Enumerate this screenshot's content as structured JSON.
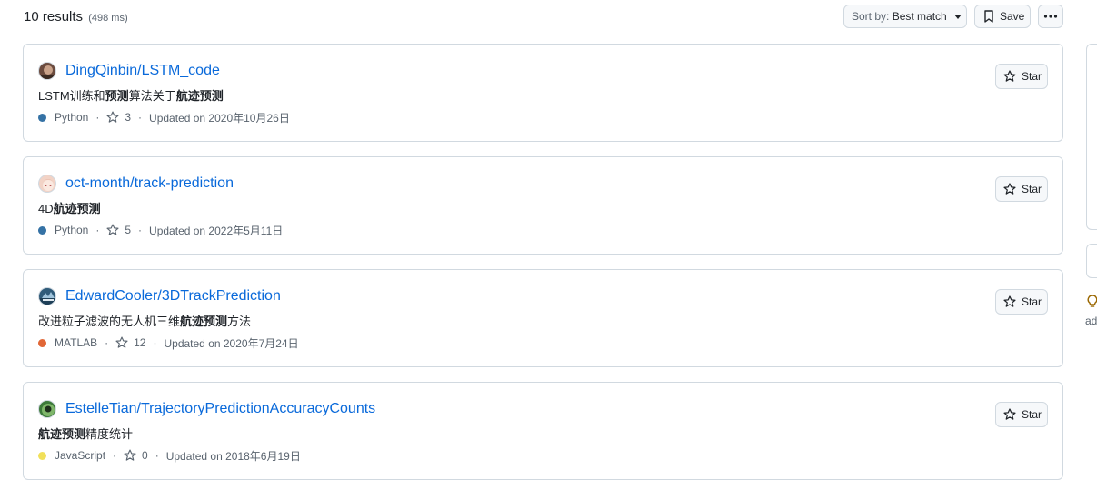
{
  "header": {
    "results_label": "10 results",
    "results_time": "(498 ms)",
    "sort_prefix": "Sort by:",
    "sort_value": "Best match",
    "save_label": "Save"
  },
  "results": [
    {
      "repo": "DingQinbin/LSTM_code",
      "desc_plain_1": "LSTM训练和",
      "desc_bold_1": "预测",
      "desc_plain_2": "算法关于",
      "desc_bold_2": "航迹预测",
      "language": "Python",
      "lang_color": "#3572A5",
      "stars": "3",
      "updated": "Updated on 2020年10月26日",
      "star_label": "Star",
      "avatar_color": "#6b4b3e"
    },
    {
      "repo": "oct-month/track-prediction",
      "desc_plain_1": "4D",
      "desc_bold_1": "航迹预测",
      "language": "Python",
      "lang_color": "#3572A5",
      "stars": "5",
      "updated": "Updated on 2022年5月11日",
      "star_label": "Star",
      "avatar_color": "#f2d3c6"
    },
    {
      "repo": "EdwardCooler/3DTrackPrediction",
      "desc_plain_1": "改进粒子滤波的无人机三维",
      "desc_bold_1": "航迹预测",
      "desc_plain_2": "方法",
      "language": "MATLAB",
      "lang_color": "#e16737",
      "stars": "12",
      "updated": "Updated on 2020年7月24日",
      "star_label": "Star",
      "avatar_color": "#2f5b7a"
    },
    {
      "repo": "EstelleTian/TrajectoryPredictionAccuracyCounts",
      "desc_bold_1": "航迹预测",
      "desc_plain_2": "精度统计",
      "language": "JavaScript",
      "lang_color": "#f1e05a",
      "stars": "0",
      "updated": "Updated on 2018年6月19日",
      "star_label": "Star",
      "avatar_color": "#3d7a3a"
    }
  ],
  "sidebar": {
    "partial_text": "ad"
  }
}
